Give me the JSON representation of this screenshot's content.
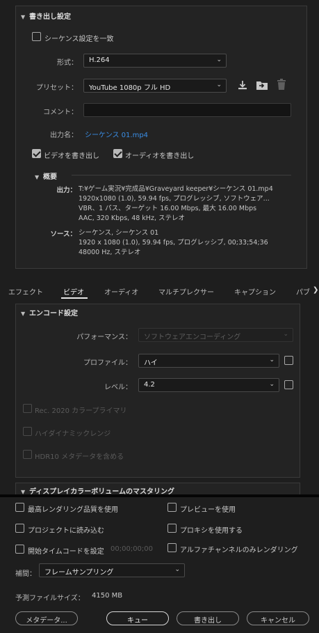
{
  "export_settings": {
    "title": "書き出し設定",
    "match_sequence": "シーケンス設定を一致",
    "format_label": "形式：",
    "format_value": "H.264",
    "preset_label": "プリセット：",
    "preset_value": "YouTube 1080p フル HD",
    "comment_label": "コメント：",
    "comment_value": "",
    "output_label": "出力名：",
    "output_value": "シーケンス 01.mp4",
    "export_video": "ビデオを書き出し",
    "export_audio": "オーディオを書き出し",
    "summary_title": "概要",
    "output_head": "出力：",
    "output_lines": [
      "T:¥ゲーム実況¥完成品¥Graveyard keeper¥シーケンス 01.mp4",
      "1920x1080 (1.0), 59.94 fps, プログレッシブ, ソフトウェア...",
      "VBR、1 パス、ターゲット 16.00 Mbps, 最大 16.00 Mbps",
      "AAC, 320 Kbps, 48 kHz, ステレオ"
    ],
    "source_head": "ソース：",
    "source_lines": [
      "シーケンス, シーケンス 01",
      "1920 x 1080 (1.0), 59.94 fps, プログレッシブ, 00;33;54;36",
      "48000 Hz, ステレオ"
    ]
  },
  "tabs": [
    "エフェクト",
    "ビデオ",
    "オーディオ",
    "マルチプレクサー",
    "キャプション",
    "パブ"
  ],
  "tabs_more": "❯",
  "encode": {
    "title": "エンコード設定",
    "performance_label": "パフォーマンス：",
    "performance_value": "ソフトウェアエンコーディング",
    "profile_label": "プロファイル：",
    "profile_value": "ハイ",
    "level_label": "レベル：",
    "level_value": "4.2",
    "rec2020": "Rec. 2020 カラープライマリ",
    "hdr": "ハイダイナミックレンジ",
    "hdr10": "HDR10 メタデータを含める"
  },
  "display_mastering_title": "ディスプレイカラーボリュームのマスタリング",
  "bottom": {
    "max_quality": "最高レンダリング品質を使用",
    "preview": "プレビューを使用",
    "import_project": "プロジェクトに読み込む",
    "proxy": "プロキシを使用する",
    "start_timecode": "開始タイムコードを設定",
    "timecode_value": "00;00;00;00",
    "alpha_only": "アルファチャンネルのみレンダリング",
    "interp_label": "補間：",
    "interp_value": "フレームサンプリング",
    "filesize_label": "予測ファイルサイズ：",
    "filesize_value": "4150 MB"
  },
  "buttons": {
    "metadata": "メタデータ...",
    "queue": "キュー",
    "export": "書き出し",
    "cancel": "キャンセル"
  },
  "colors": {
    "accent_link": "#3a8ee6",
    "background": "#1e1e1e"
  }
}
